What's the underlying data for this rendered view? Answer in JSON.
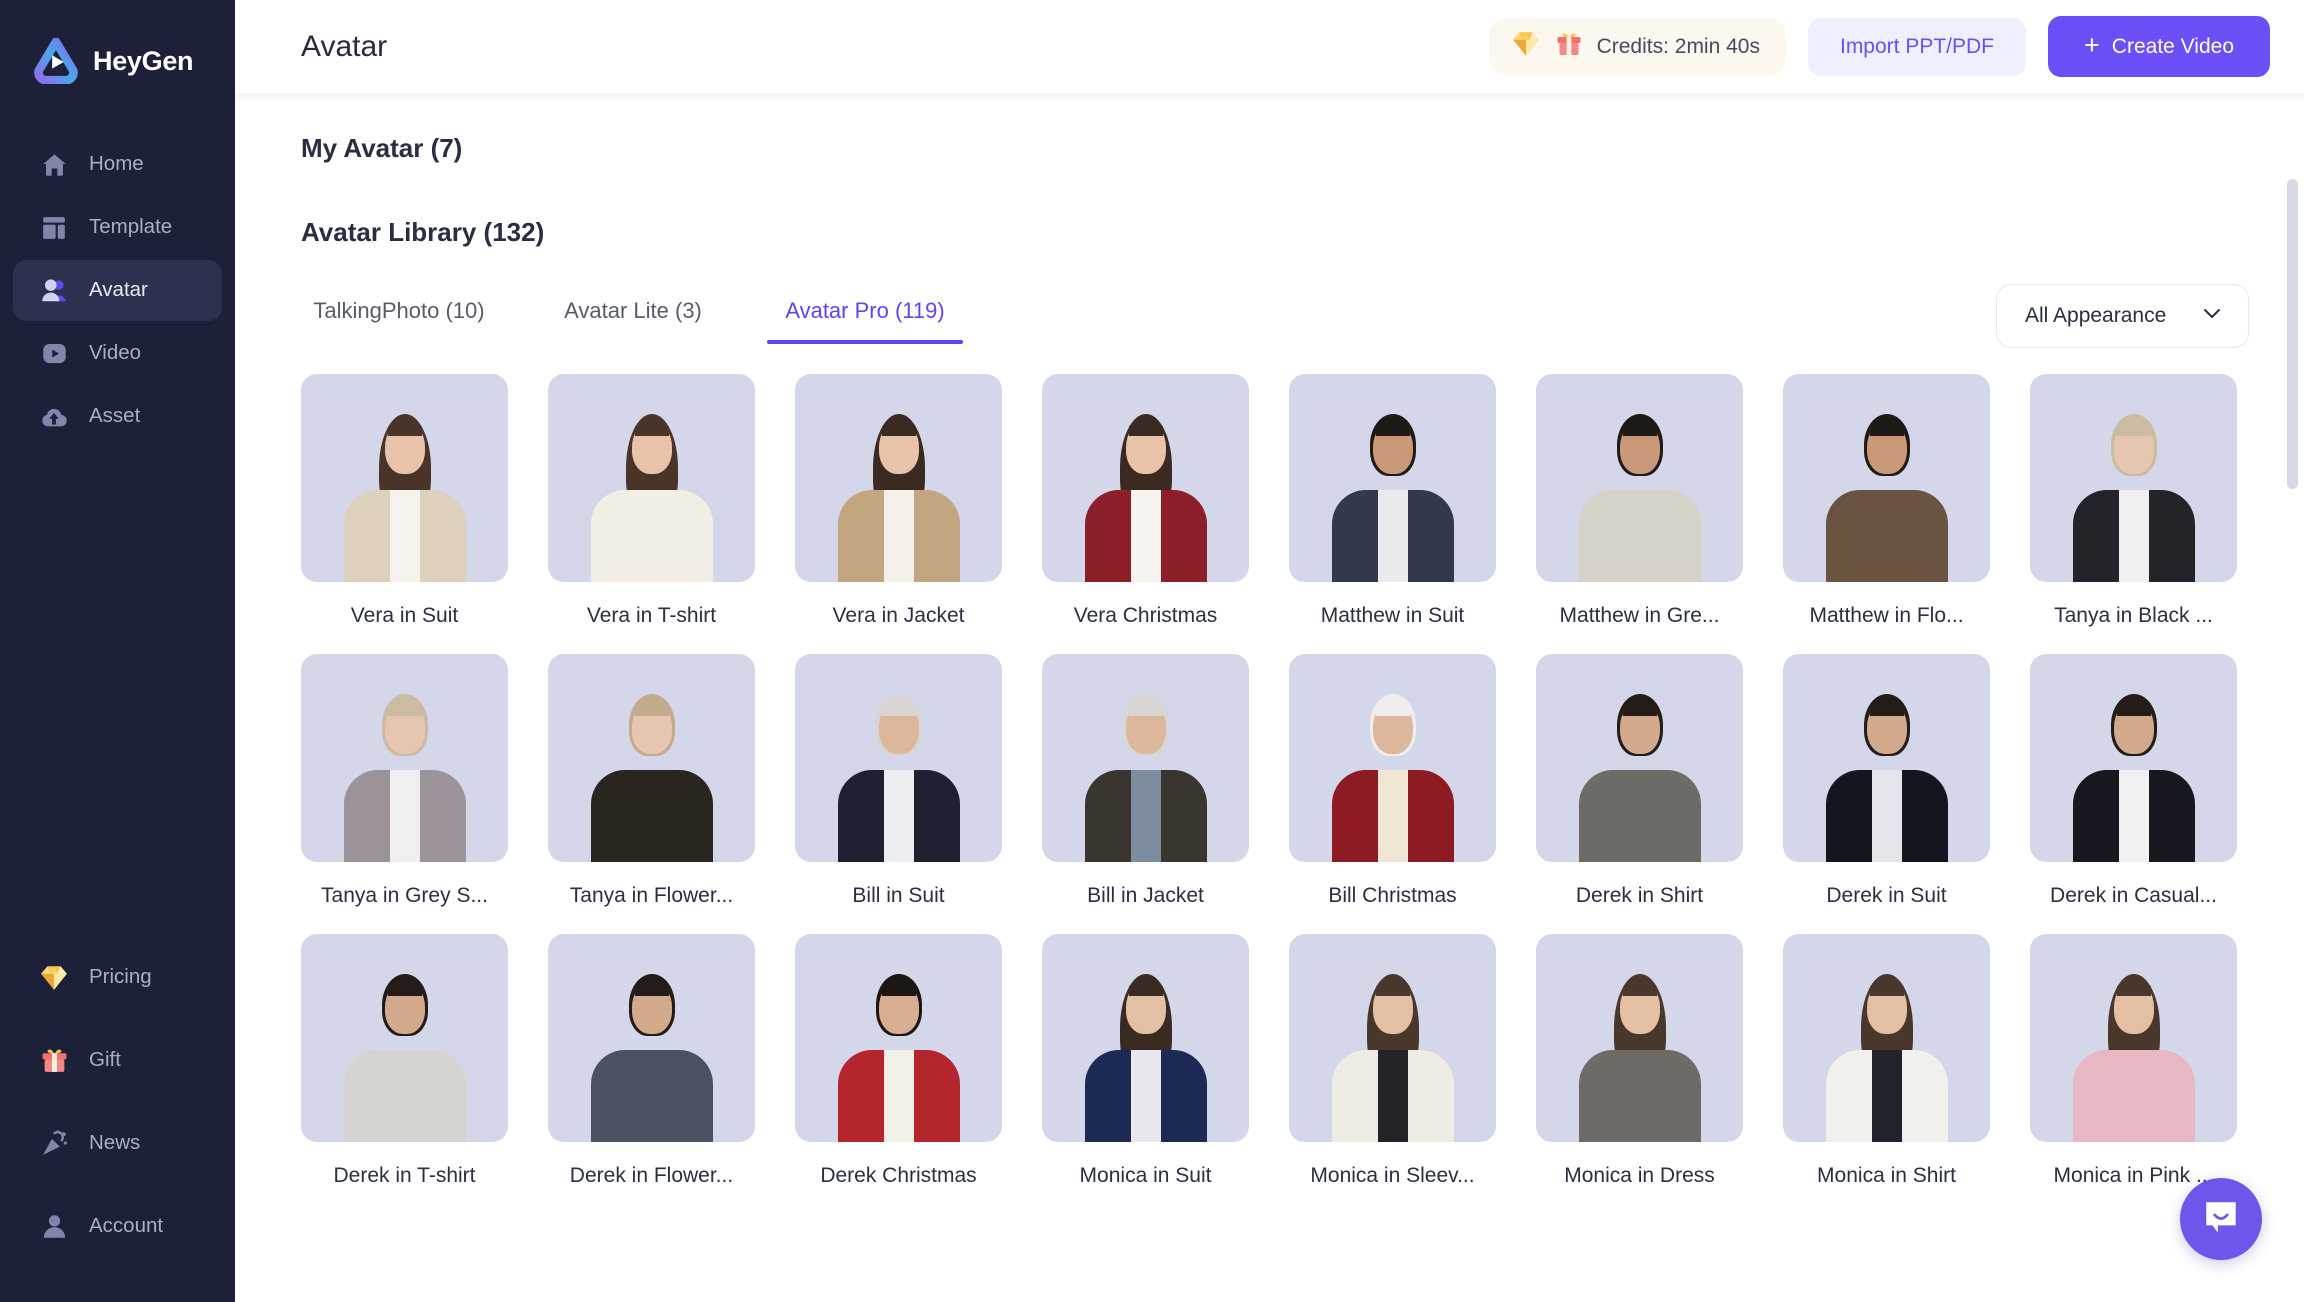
{
  "brand": {
    "name": "HeyGen",
    "logo_icon": "heygen-play-logo"
  },
  "sidebar": {
    "top_items": [
      {
        "label": "Home",
        "icon": "home-icon",
        "active": false
      },
      {
        "label": "Template",
        "icon": "template-icon",
        "active": false
      },
      {
        "label": "Avatar",
        "icon": "avatar-people-icon",
        "active": true
      },
      {
        "label": "Video",
        "icon": "video-play-icon",
        "active": false
      },
      {
        "label": "Asset",
        "icon": "asset-cloud-icon",
        "active": false
      }
    ],
    "bottom_items": [
      {
        "label": "Pricing",
        "icon": "diamond-icon"
      },
      {
        "label": "Gift",
        "icon": "gift-icon"
      },
      {
        "label": "News",
        "icon": "party-popper-icon"
      },
      {
        "label": "Account",
        "icon": "person-icon"
      }
    ]
  },
  "header": {
    "title": "Avatar",
    "credits_label": "Credits: 2min 40s",
    "credits_icons": [
      "diamond-icon",
      "gift-icon"
    ],
    "import_label": "Import PPT/PDF",
    "create_label": "Create Video",
    "create_plus": "+"
  },
  "sections": {
    "my_avatar": "My Avatar (7)",
    "avatar_library": "Avatar Library (132)"
  },
  "tabs": [
    {
      "label": "TalkingPhoto (10)",
      "active": false
    },
    {
      "label": "Avatar Lite (3)",
      "active": false
    },
    {
      "label": "Avatar Pro (119)",
      "active": true
    }
  ],
  "filter": {
    "label": "All Appearance",
    "icon": "chevron-down-icon"
  },
  "colors": {
    "accent": "#6243f0",
    "accent_button": "#6c4ff6",
    "sidebar_bg": "#1c2039",
    "sidebar_active": "#2c3150",
    "card_bg": "#d3d7e9",
    "credits_pill_bg": "#fdf8ef",
    "import_bg": "#eeefff",
    "chat_fab": "#6f55ec"
  },
  "avatars": [
    {
      "label": "Vera in Suit",
      "skin": "#e8c3aa",
      "hair": "#4a342a",
      "outfit": "#ddd1bd",
      "inner": "#f6f3ec",
      "long_hair": true
    },
    {
      "label": "Vera in T-shirt",
      "skin": "#e8c3aa",
      "hair": "#4a342a",
      "outfit": "#f2eee3",
      "inner": "#f2eee3",
      "long_hair": true
    },
    {
      "label": "Vera in Jacket",
      "skin": "#e8c3aa",
      "hair": "#3b2a22",
      "outfit": "#c3a680",
      "inner": "#f3f1ea",
      "long_hair": true
    },
    {
      "label": "Vera Christmas",
      "skin": "#e8c3aa",
      "hair": "#3b2a22",
      "outfit": "#8d1f2a",
      "inner": "#f7f4ef",
      "long_hair": true
    },
    {
      "label": "Matthew in Suit",
      "skin": "#c89878",
      "hair": "#201a17",
      "outfit": "#33384a",
      "inner": "#e9eaee",
      "long_hair": false
    },
    {
      "label": "Matthew in Gre...",
      "skin": "#c89878",
      "hair": "#201a17",
      "outfit": "#d7d2c6",
      "inner": "#d7d2c6",
      "long_hair": false
    },
    {
      "label": "Matthew in Flo...",
      "skin": "#c89878",
      "hair": "#201a17",
      "outfit": "#6a5340",
      "inner": "#6a5340",
      "long_hair": false
    },
    {
      "label": "Tanya in Black ...",
      "skin": "#e6c6b1",
      "hair": "#cbbba2",
      "outfit": "#23232a",
      "inner": "#efefef",
      "long_hair": false
    },
    {
      "label": "Tanya in Grey S...",
      "skin": "#e6c6b1",
      "hair": "#cbbba2",
      "outfit": "#9b9399",
      "inner": "#f0eeee",
      "long_hair": false
    },
    {
      "label": "Tanya in Flower...",
      "skin": "#e6c6b1",
      "hair": "#c2ab8c",
      "outfit": "#2b2520",
      "inner": "#2b2520",
      "long_hair": false
    },
    {
      "label": "Bill in Suit",
      "skin": "#ddb79c",
      "hair": "#d8d6d2",
      "outfit": "#1e2230",
      "inner": "#eceef2",
      "long_hair": false
    },
    {
      "label": "Bill in Jacket",
      "skin": "#ddb79c",
      "hair": "#d8d6d2",
      "outfit": "#3b352f",
      "inner": "#7e8ca0",
      "long_hair": false
    },
    {
      "label": "Bill Christmas",
      "skin": "#ddb79c",
      "hair": "#eeeeee",
      "outfit": "#8e1a23",
      "inner": "#efe6d6",
      "long_hair": false
    },
    {
      "label": "Derek in Shirt",
      "skin": "#d3a98c",
      "hair": "#241c18",
      "outfit": "#6d6b66",
      "inner": "#6d6b66",
      "long_hair": false
    },
    {
      "label": "Derek in Suit",
      "skin": "#d3a98c",
      "hair": "#241c18",
      "outfit": "#14161f",
      "inner": "#e4e5ea",
      "long_hair": false
    },
    {
      "label": "Derek in Casual...",
      "skin": "#d3a98c",
      "hair": "#241c18",
      "outfit": "#17181f",
      "inner": "#f1f1f3",
      "long_hair": false
    },
    {
      "label": "Derek in T-shirt",
      "skin": "#d3a98c",
      "hair": "#241c18",
      "outfit": "#d6d4d0",
      "inner": "#d6d4d0",
      "long_hair": false
    },
    {
      "label": "Derek in Flower...",
      "skin": "#d3a98c",
      "hair": "#241c18",
      "outfit": "#4c5360",
      "inner": "#4c5360",
      "long_hair": false
    },
    {
      "label": "Derek Christmas",
      "skin": "#d8ae92",
      "hair": "#1d1713",
      "outfit": "#b5262c",
      "inner": "#f3f0ea",
      "long_hair": false
    },
    {
      "label": "Monica in Suit",
      "skin": "#e3bfa3",
      "hair": "#3a2b22",
      "outfit": "#1d2a55",
      "inner": "#e6e8ee",
      "long_hair": true
    },
    {
      "label": "Monica in Sleev...",
      "skin": "#e3bfa3",
      "hair": "#4a372b",
      "outfit": "#efece4",
      "inner": "#23232a",
      "long_hair": true
    },
    {
      "label": "Monica in Dress",
      "skin": "#e3bfa3",
      "hair": "#4a372b",
      "outfit": "#6e6a67",
      "inner": "#6e6a67",
      "long_hair": true
    },
    {
      "label": "Monica in Shirt",
      "skin": "#e3bfa3",
      "hair": "#4a372b",
      "outfit": "#f2f0ec",
      "inner": "#22242c",
      "long_hair": true
    },
    {
      "label": "Monica in Pink ...",
      "skin": "#e3bfa3",
      "hair": "#4a372b",
      "outfit": "#e7b8c4",
      "inner": "#e7b8c4",
      "long_hair": true
    }
  ],
  "chat": {
    "icon": "chat-bubble-icon"
  },
  "scrollbar": {
    "name": "vertical-scrollbar"
  }
}
